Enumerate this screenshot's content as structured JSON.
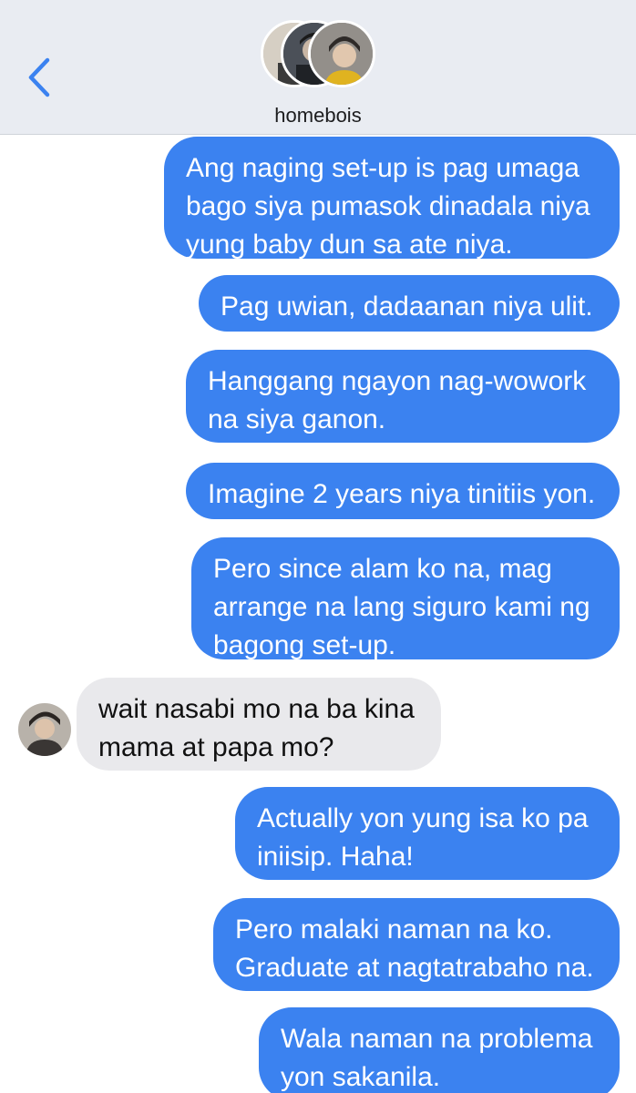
{
  "header": {
    "group_name": "homebois",
    "back_icon": "chevron-left-icon",
    "accent_color": "#3b82f0"
  },
  "messages": [
    {
      "direction": "sent",
      "text": "Ang naging set-up is pag umaga\nbago siya pumasok dinadala niya\nyung baby dun sa ate niya."
    },
    {
      "direction": "sent",
      "text": "Pag uwian, dadaanan niya ulit."
    },
    {
      "direction": "sent",
      "text": "Hanggang ngayon nag-wowork\nna siya ganon."
    },
    {
      "direction": "sent",
      "text": "Imagine 2 years niya tinitiis yon."
    },
    {
      "direction": "sent",
      "text": "Pero since alam ko na, mag\narrange na lang siguro kami ng\nbagong set-up."
    },
    {
      "direction": "received",
      "text": "wait nasabi mo na ba kina\nmama at papa mo?"
    },
    {
      "direction": "sent",
      "text": "Actually yon yung isa ko pa\niniisip. Haha!"
    },
    {
      "direction": "sent",
      "text": "Pero malaki naman na ko.\nGraduate at nagtatrabaho na."
    },
    {
      "direction": "sent",
      "text": "Wala naman na problema\nyon sakanila."
    }
  ]
}
